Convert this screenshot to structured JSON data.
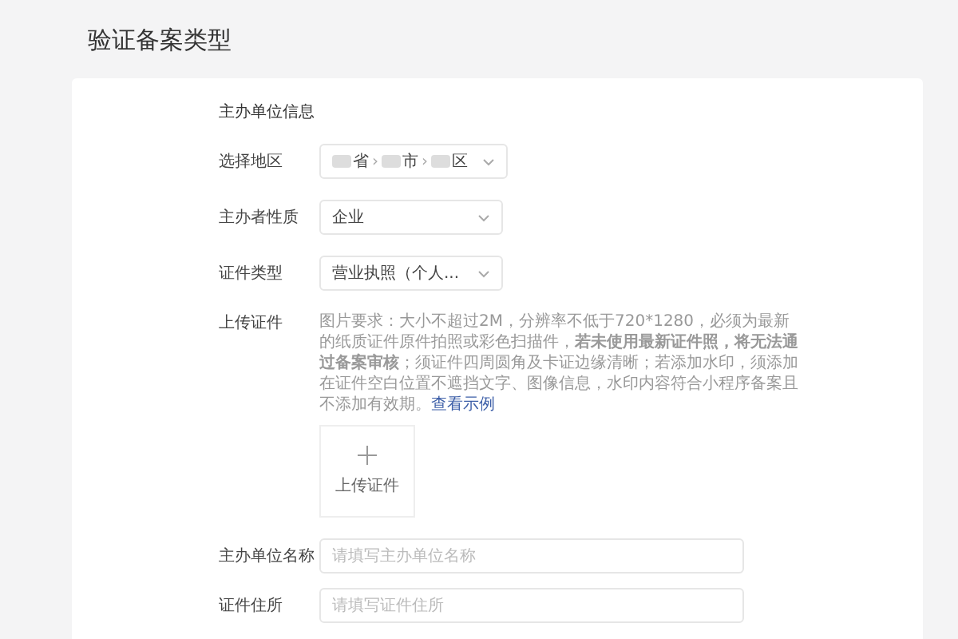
{
  "page_title": "验证备案类型",
  "section_title": "主办单位信息",
  "region": {
    "label": "选择地区",
    "parts": [
      "省",
      "市",
      "区"
    ],
    "separator": "›"
  },
  "selects": [
    {
      "label": "主办者性质",
      "value": "企业"
    },
    {
      "label": "证件类型",
      "value": "营业执照（个人..."
    }
  ],
  "upload": {
    "label": "上传证件",
    "description": "图片要求：大小不超过2M，分辨率不低于720*1280，必须为最新的纸质证件原件拍照或彩色扫描件，**若未使用最新证件照，将无法通过备案审核**；须证件四周圆角及卡证边缘清晰；若添加水印，须添加在证件空白位置不遮挡文字、图像信息，水印内容符合小程序备案且不添加有效期。",
    "link": "查看示例",
    "button": "上传证件"
  },
  "inputs": [
    {
      "label": "主办单位名称",
      "placeholder": "请填写主办单位名称"
    },
    {
      "label": "证件住所",
      "placeholder": "请填写证件住所"
    }
  ]
}
